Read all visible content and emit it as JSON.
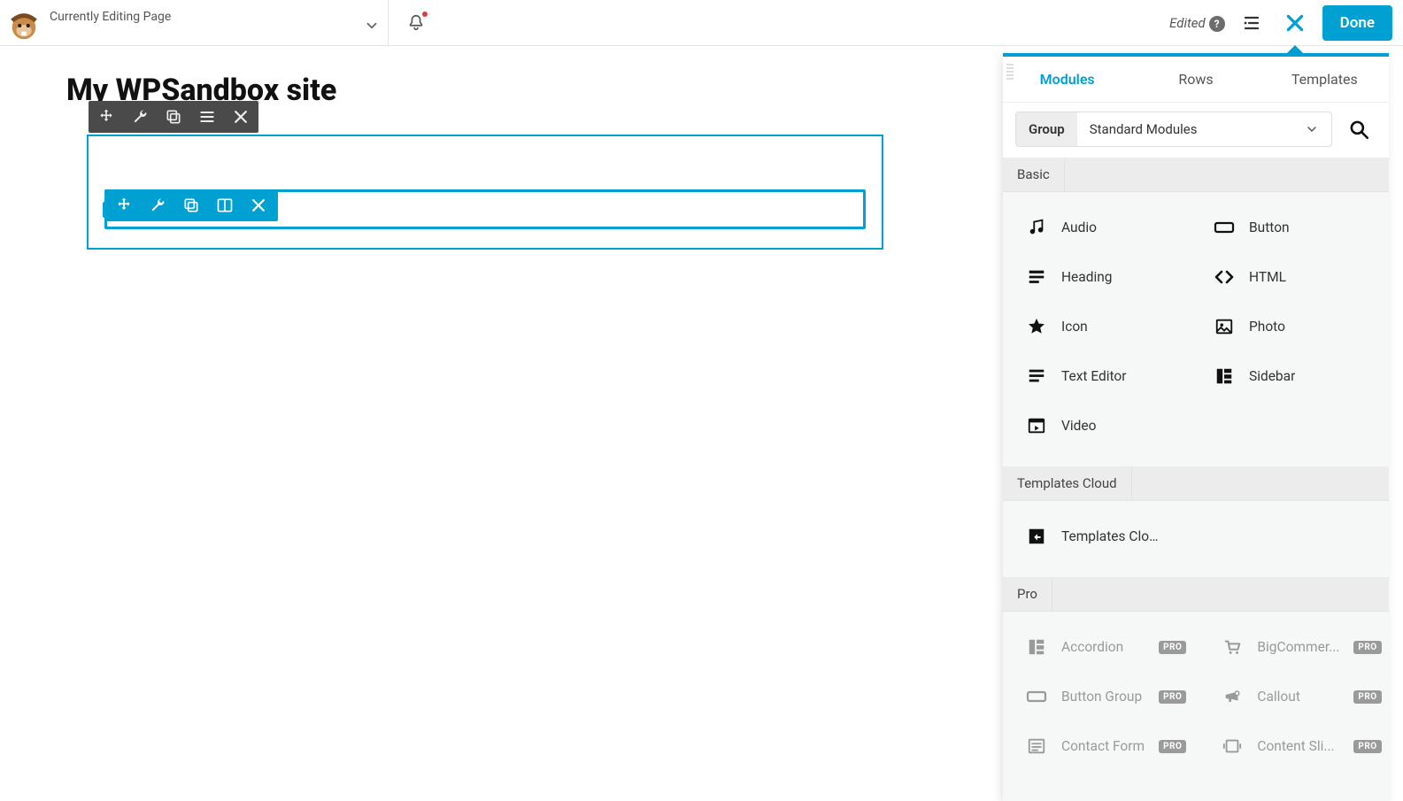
{
  "topbar": {
    "editing_label": "Currently Editing Page",
    "edited_label": "Edited",
    "done_label": "Done"
  },
  "page": {
    "title": "My WPSandbox site"
  },
  "panel": {
    "tabs": {
      "modules": "Modules",
      "rows": "Rows",
      "templates": "Templates"
    },
    "group_label": "Group",
    "group_value": "Standard Modules",
    "sections": {
      "basic": {
        "title": "Basic",
        "items": {
          "audio": "Audio",
          "button": "Button",
          "heading": "Heading",
          "html": "HTML",
          "icon": "Icon",
          "photo": "Photo",
          "text_editor": "Text Editor",
          "sidebar": "Sidebar",
          "video": "Video"
        }
      },
      "templates_cloud": {
        "title": "Templates Cloud",
        "items": {
          "templates_cloud": "Templates Cloud"
        }
      },
      "pro": {
        "title": "Pro",
        "badge": "PRO",
        "items": {
          "accordion": "Accordion",
          "bigcommerce": "BigCommer...",
          "button_group": "Button Group",
          "callout": "Callout",
          "contact_form": "Contact Form",
          "content_slider": "Content Sli..."
        }
      }
    }
  }
}
